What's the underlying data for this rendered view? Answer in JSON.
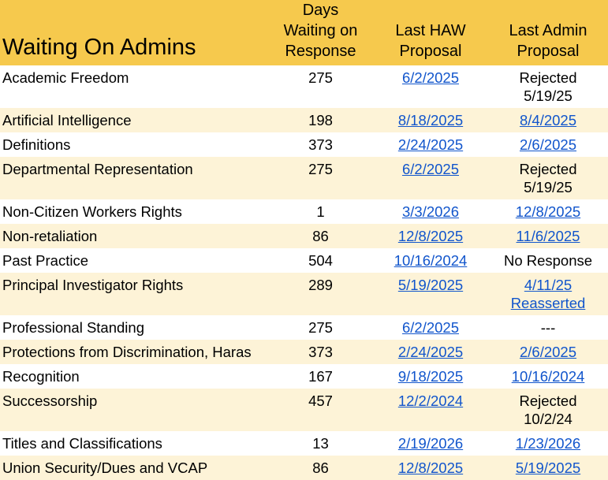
{
  "header": {
    "title": "Waiting On Admins",
    "col_days": "Days\nWaiting on\nResponse",
    "col_haw": "Last HAW\nProposal",
    "col_admin": "Last Admin\nProposal"
  },
  "rows": [
    {
      "name": "Academic Freedom",
      "days": "275",
      "haw": "6/2/2025",
      "admin_line1": "Rejected",
      "admin_line2": "5/19/25",
      "admin_link": false
    },
    {
      "name": "Artificial Intelligence",
      "days": "198",
      "haw": "8/18/2025",
      "admin_line1": "8/4/2025",
      "admin_line2": "",
      "admin_link": true
    },
    {
      "name": "Definitions",
      "days": "373",
      "haw": "2/24/2025",
      "admin_line1": "2/6/2025",
      "admin_line2": "",
      "admin_link": true
    },
    {
      "name": "Departmental Representation",
      "days": "275",
      "haw": "6/2/2025",
      "admin_line1": "Rejected",
      "admin_line2": "5/19/25",
      "admin_link": false
    },
    {
      "name": "Non-Citizen Workers Rights",
      "days": "1",
      "haw": "3/3/2026",
      "admin_line1": "12/8/2025",
      "admin_line2": "",
      "admin_link": true
    },
    {
      "name": "Non-retaliation",
      "days": "86",
      "haw": "12/8/2025",
      "admin_line1": "11/6/2025",
      "admin_line2": "",
      "admin_link": true
    },
    {
      "name": "Past Practice",
      "days": "504",
      "haw": "10/16/2024",
      "admin_line1": "No Response",
      "admin_line2": "",
      "admin_link": false
    },
    {
      "name": "Principal Investigator Rights",
      "days": "289",
      "haw": "5/19/2025",
      "admin_line1": "4/11/25",
      "admin_line2": "Reasserted",
      "admin_link": true
    },
    {
      "name": "Professional Standing",
      "days": "275",
      "haw": "6/2/2025",
      "admin_line1": "---",
      "admin_line2": "",
      "admin_link": false
    },
    {
      "name": "Protections from Discrimination, Haras",
      "days": "373",
      "haw": "2/24/2025",
      "admin_line1": "2/6/2025",
      "admin_line2": "",
      "admin_link": true
    },
    {
      "name": "Recognition",
      "days": "167",
      "haw": "9/18/2025",
      "admin_line1": "10/16/2024",
      "admin_line2": "",
      "admin_link": true
    },
    {
      "name": "Successorship",
      "days": "457",
      "haw": "12/2/2024",
      "admin_line1": "Rejected",
      "admin_line2": "10/2/24",
      "admin_link": false
    },
    {
      "name": "Titles and Classifications",
      "days": "13",
      "haw": "2/19/2026",
      "admin_line1": "1/23/2026",
      "admin_line2": "",
      "admin_link": true
    },
    {
      "name": "Union Security/Dues and VCAP",
      "days": "86",
      "haw": "12/8/2025",
      "admin_line1": "5/19/2025",
      "admin_line2": "",
      "admin_link": true
    }
  ]
}
